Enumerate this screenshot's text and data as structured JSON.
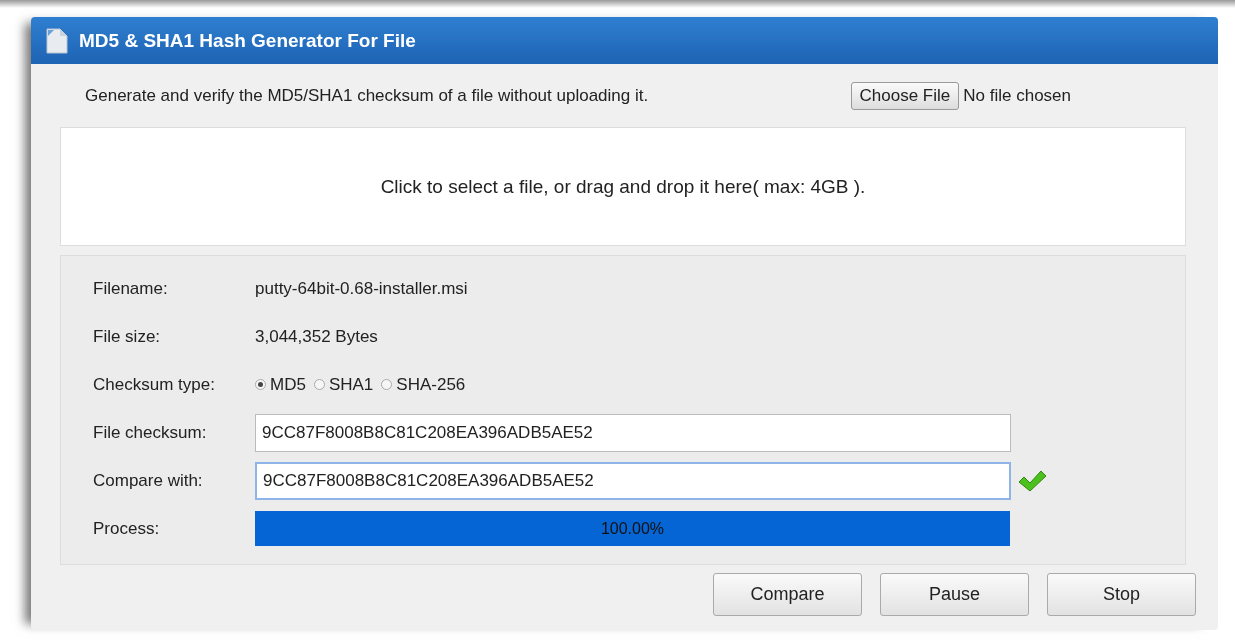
{
  "window": {
    "title": "MD5 & SHA1 Hash Generator For File"
  },
  "intro": "Generate and verify the MD5/SHA1 checksum of a file without uploading it.",
  "file_input": {
    "button": "Choose File",
    "status": "No file chosen"
  },
  "dropzone": {
    "text": "Click to select a file, or drag and drop it here( max: 4GB )."
  },
  "details": {
    "filename": {
      "label": "Filename:",
      "value": "putty-64bit-0.68-installer.msi"
    },
    "file_size": {
      "label": "File size:",
      "value": "3,044,352 Bytes"
    },
    "checksum_type": {
      "label": "Checksum type:",
      "options": [
        {
          "label": "MD5",
          "selected": true
        },
        {
          "label": "SHA1",
          "selected": false
        },
        {
          "label": "SHA-256",
          "selected": false
        }
      ]
    },
    "file_checksum": {
      "label": "File checksum:",
      "value": "9CC87F8008B8C81C208EA396ADB5AE52"
    },
    "compare_with": {
      "label": "Compare with:",
      "value": "9CC87F8008B8C81C208EA396ADB5AE52",
      "focused": true,
      "matched": true
    },
    "process": {
      "label": "Process:",
      "level": 1,
      "reading": "100.00%"
    }
  },
  "buttons": [
    "Compare",
    "Pause",
    "Stop"
  ]
}
